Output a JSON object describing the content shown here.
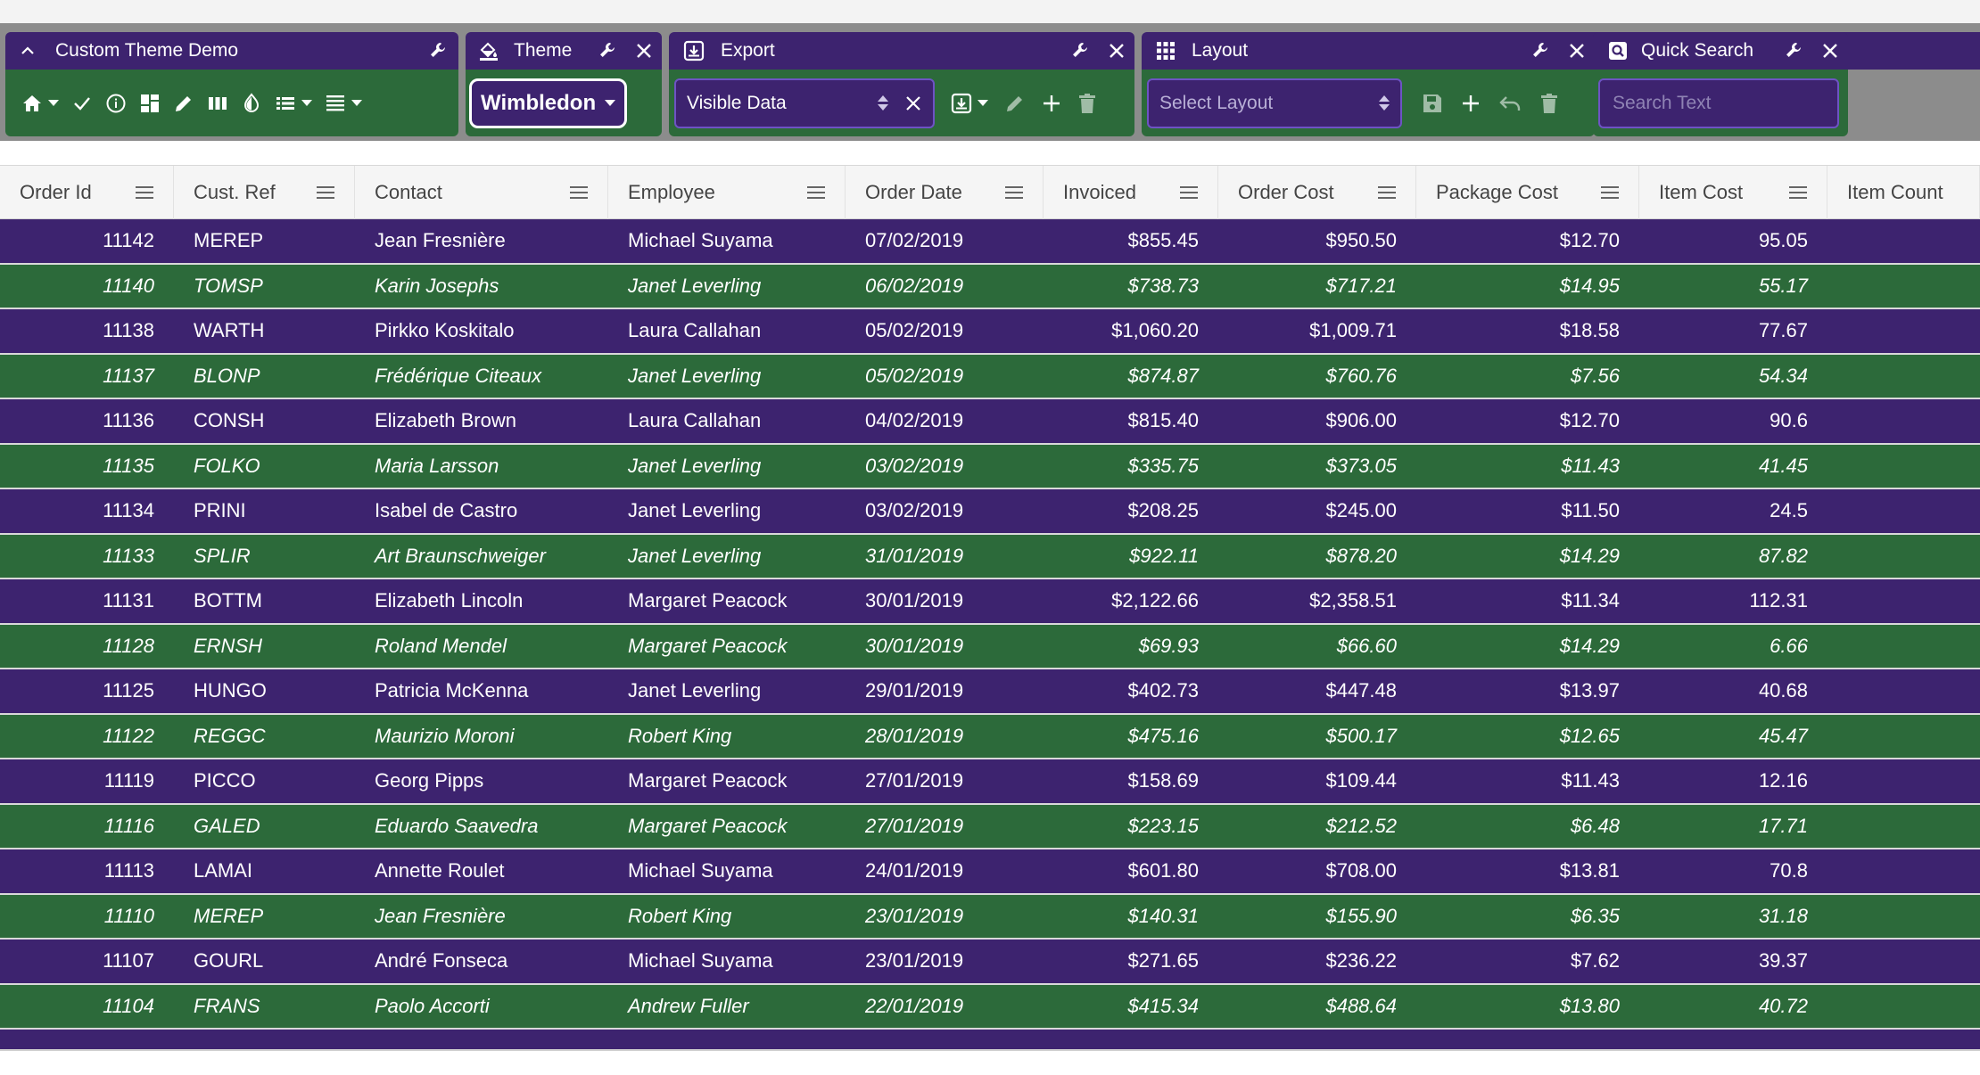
{
  "dashboard": {
    "home": {
      "title": "Custom Theme Demo"
    },
    "theme": {
      "title": "Theme",
      "selected": "Wimbledon"
    },
    "export": {
      "title": "Export",
      "selected": "Visible Data"
    },
    "layout": {
      "title": "Layout",
      "placeholder": "Select Layout"
    },
    "quick_search": {
      "title": "Quick Search",
      "placeholder": "Search Text"
    }
  },
  "colors": {
    "header_purple": "#3d236f",
    "body_green": "#2c6a3a",
    "accent_border": "#6e53c4",
    "dashboard_bg": "#8c8c8c"
  },
  "grid": {
    "columns": [
      "Order Id",
      "Cust. Ref",
      "Contact",
      "Employee",
      "Order Date",
      "Invoiced",
      "Order Cost",
      "Package Cost",
      "Item Cost",
      "Item Count"
    ],
    "rows": [
      [
        "11142",
        "MEREP",
        "Jean Fresnière",
        "Michael Suyama",
        "07/02/2019",
        "$855.45",
        "$950.50",
        "$12.70",
        "95.05"
      ],
      [
        "11140",
        "TOMSP",
        "Karin Josephs",
        "Janet Leverling",
        "06/02/2019",
        "$738.73",
        "$717.21",
        "$14.95",
        "55.17"
      ],
      [
        "11138",
        "WARTH",
        "Pirkko Koskitalo",
        "Laura Callahan",
        "05/02/2019",
        "$1,060.20",
        "$1,009.71",
        "$18.58",
        "77.67"
      ],
      [
        "11137",
        "BLONP",
        "Frédérique Citeaux",
        "Janet Leverling",
        "05/02/2019",
        "$874.87",
        "$760.76",
        "$7.56",
        "54.34"
      ],
      [
        "11136",
        "CONSH",
        "Elizabeth Brown",
        "Laura Callahan",
        "04/02/2019",
        "$815.40",
        "$906.00",
        "$12.70",
        "90.6"
      ],
      [
        "11135",
        "FOLKO",
        "Maria Larsson",
        "Janet Leverling",
        "03/02/2019",
        "$335.75",
        "$373.05",
        "$11.43",
        "41.45"
      ],
      [
        "11134",
        "PRINI",
        "Isabel de Castro",
        "Janet Leverling",
        "03/02/2019",
        "$208.25",
        "$245.00",
        "$11.50",
        "24.5"
      ],
      [
        "11133",
        "SPLIR",
        "Art Braunschweiger",
        "Janet Leverling",
        "31/01/2019",
        "$922.11",
        "$878.20",
        "$14.29",
        "87.82"
      ],
      [
        "11131",
        "BOTTM",
        "Elizabeth Lincoln",
        "Margaret Peacock",
        "30/01/2019",
        "$2,122.66",
        "$2,358.51",
        "$11.34",
        "112.31"
      ],
      [
        "11128",
        "ERNSH",
        "Roland Mendel",
        "Margaret Peacock",
        "30/01/2019",
        "$69.93",
        "$66.60",
        "$14.29",
        "6.66"
      ],
      [
        "11125",
        "HUNGO",
        "Patricia McKenna",
        "Janet Leverling",
        "29/01/2019",
        "$402.73",
        "$447.48",
        "$13.97",
        "40.68"
      ],
      [
        "11122",
        "REGGC",
        "Maurizio Moroni",
        "Robert King",
        "28/01/2019",
        "$475.16",
        "$500.17",
        "$12.65",
        "45.47"
      ],
      [
        "11119",
        "PICCO",
        "Georg Pipps",
        "Margaret Peacock",
        "27/01/2019",
        "$158.69",
        "$109.44",
        "$11.43",
        "12.16"
      ],
      [
        "11116",
        "GALED",
        "Eduardo Saavedra",
        "Margaret Peacock",
        "27/01/2019",
        "$223.15",
        "$212.52",
        "$6.48",
        "17.71"
      ],
      [
        "11113",
        "LAMAI",
        "Annette Roulet",
        "Michael Suyama",
        "24/01/2019",
        "$601.80",
        "$708.00",
        "$13.81",
        "70.8"
      ],
      [
        "11110",
        "MEREP",
        "Jean Fresnière",
        "Robert King",
        "23/01/2019",
        "$140.31",
        "$155.90",
        "$6.35",
        "31.18"
      ],
      [
        "11107",
        "GOURL",
        "André Fonseca",
        "Michael Suyama",
        "23/01/2019",
        "$271.65",
        "$236.22",
        "$7.62",
        "39.37"
      ],
      [
        "11104",
        "FRANS",
        "Paolo Accorti",
        "Andrew Fuller",
        "22/01/2019",
        "$415.34",
        "$488.64",
        "$13.80",
        "40.72"
      ]
    ]
  }
}
